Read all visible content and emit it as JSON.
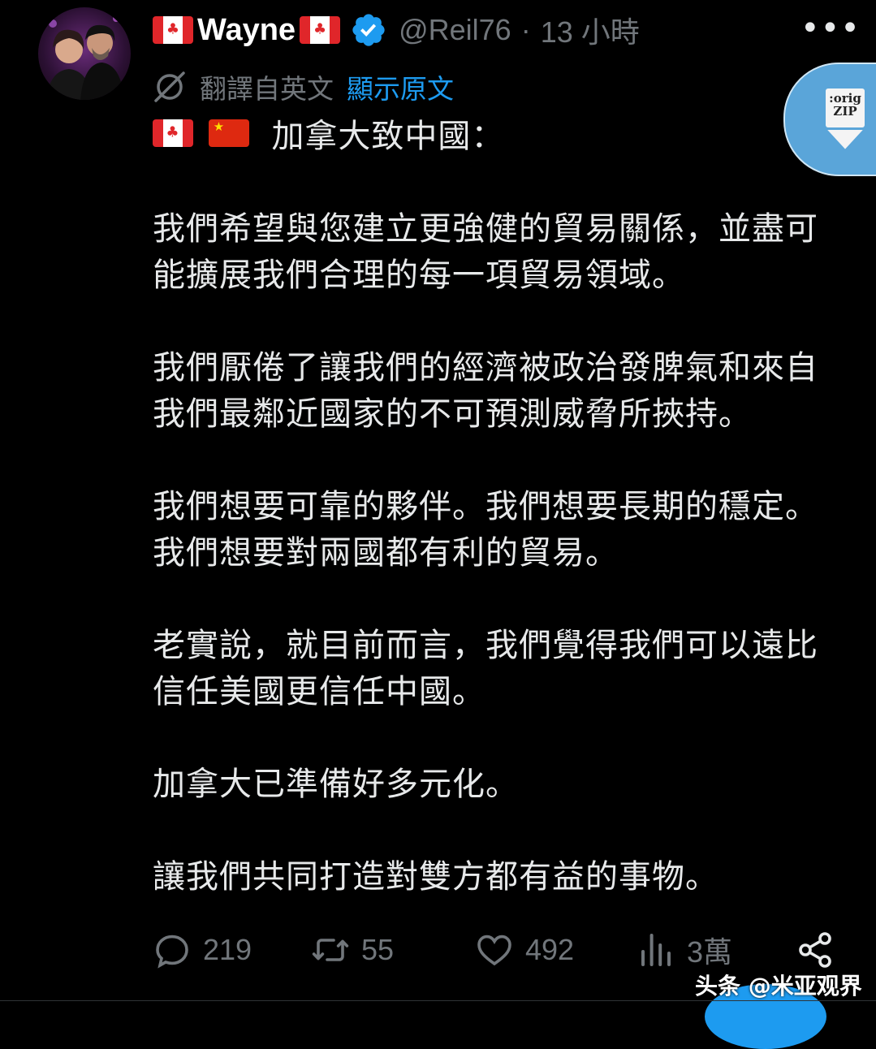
{
  "author": {
    "display_name": "Wayne",
    "handle": "@Reil76",
    "separator": "·",
    "time_ago": "13 小時"
  },
  "translation": {
    "label": "翻譯自英文",
    "show_original": "顯示原文"
  },
  "overlay_button": {
    "line1": ":orig",
    "line2": "ZIP"
  },
  "post": {
    "title": "加拿大致中國：",
    "lines": [
      "我們希望與您建立更強健的貿易關係，並盡可",
      "能擴展我們合理的每一項貿易領域。",
      "我們厭倦了讓我們的經濟被政治發脾氣和來自",
      "我們最鄰近國家的不可預測威脅所挾持。",
      "我們想要可靠的夥伴。我們想要長期的穩定。",
      "我們想要對兩國都有利的貿易。",
      "老實說，就目前而言，我們覺得我們可以遠比",
      "信任美國更信任中國。",
      "加拿大已準備好多元化。",
      "讓我們共同打造對雙方都有益的事物。"
    ]
  },
  "actions": {
    "replies": "219",
    "reposts": "55",
    "likes": "492",
    "views": "3萬"
  },
  "watermark": "头条 @米亚观界",
  "colors": {
    "background": "#000000",
    "text": "#e7e9ea",
    "muted": "#71767b",
    "link": "#1d9bf0",
    "verified": "#1d9bf0"
  }
}
